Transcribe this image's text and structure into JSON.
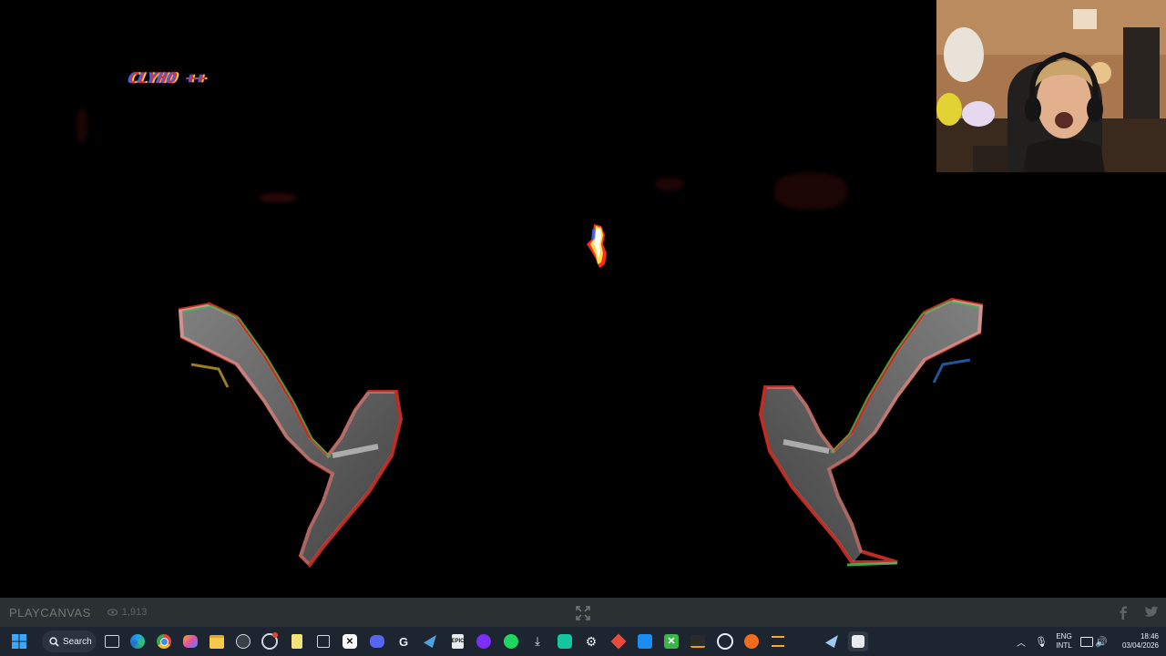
{
  "game": {
    "hud_text": "CLYHO ++"
  },
  "playcanvas_bar": {
    "logo_text": "PLAYCANVAS",
    "views_count": "1,913"
  },
  "taskbar": {
    "search_label": "Search",
    "apps": [
      "start",
      "search",
      "file-explorer",
      "edge",
      "chrome",
      "copilot",
      "folder",
      "obs",
      "app",
      "notes",
      "calendar",
      "capcut",
      "discord",
      "games",
      "steam",
      "epic",
      "app",
      "spotify",
      "download",
      "app",
      "settings",
      "app",
      "vscode",
      "app",
      "xbox",
      "amazon",
      "app",
      "app",
      "app",
      "steam",
      "app"
    ],
    "tray": {
      "lang_line1": "ENG",
      "lang_line2": "INTL",
      "time": "18:46",
      "date": "03/04/2026"
    }
  }
}
